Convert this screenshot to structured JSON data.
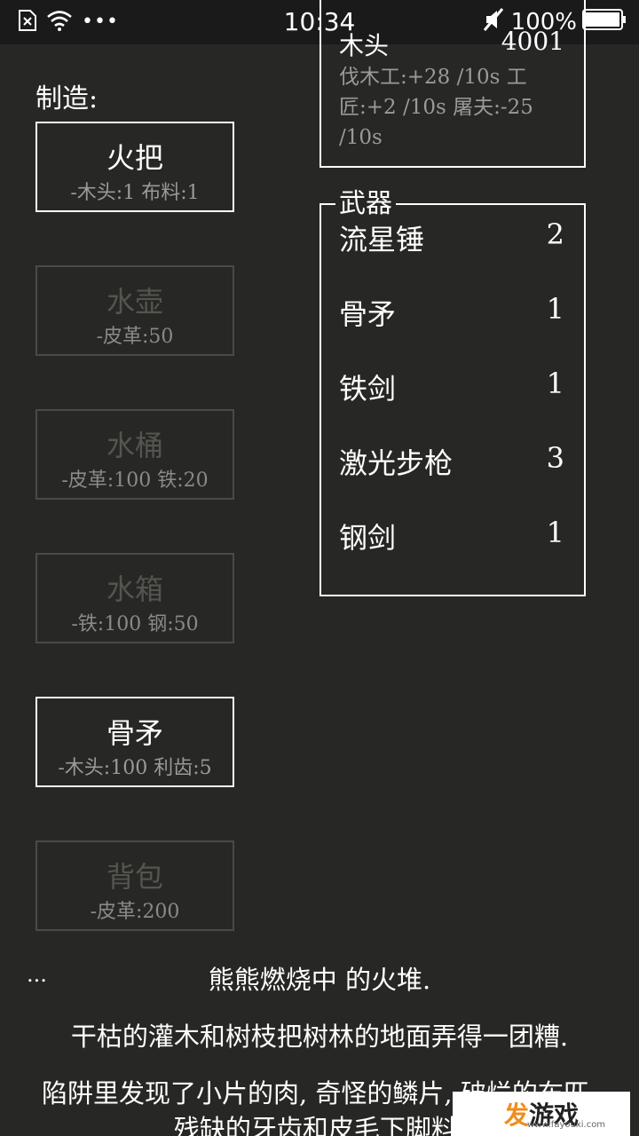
{
  "status_bar": {
    "time": "10:34",
    "battery": "100%",
    "icons": [
      "sim-card-icon",
      "wifi-icon",
      "more-dots-icon",
      "mute-icon",
      "battery-icon"
    ]
  },
  "build": {
    "label": "制造:",
    "items": [
      {
        "name": "火把",
        "cost": "-木头:1 布料:1",
        "enabled": true
      },
      {
        "name": "水壶",
        "cost": "-皮革:50",
        "enabled": false
      },
      {
        "name": "水桶",
        "cost": "-皮革:100 铁:20",
        "enabled": false
      },
      {
        "name": "水箱",
        "cost": "-铁:100 钢:50",
        "enabled": false
      },
      {
        "name": "骨矛",
        "cost": "-木头:100 利齿:5",
        "enabled": true
      },
      {
        "name": "背包",
        "cost": "-皮革:200",
        "enabled": false
      }
    ]
  },
  "stores": {
    "row_name": "木头",
    "row_value": "4001",
    "tooltip": "伐木工:+28 /10s 工匠:+2 /10s 屠夫:-25 /10s"
  },
  "weapons": {
    "title": "武器",
    "items": [
      {
        "name": "流星锤",
        "count": "2"
      },
      {
        "name": "骨矛",
        "count": "1"
      },
      {
        "name": "铁剑",
        "count": "1"
      },
      {
        "name": "激光步枪",
        "count": "3"
      },
      {
        "name": "钢剑",
        "count": "1"
      }
    ]
  },
  "notifications": {
    "ellipsis": "...",
    "messages": [
      "熊熊燃烧中 的火堆.",
      "干枯的灌木和树枝把树林的地面弄得一团糟.",
      "陷阱里发现了小片的肉, 奇怪的鳞片, 破烂的布匹, 残缺的牙齿和皮毛下脚料."
    ]
  },
  "watermark": {
    "logo_accent": "发",
    "logo_rest": "游戏",
    "url": "www.fayouxi.com"
  },
  "colors": {
    "background": "#272725",
    "text": "#ffffff",
    "muted": "#9a9a98",
    "disabled_border": "#4a4a48",
    "disabled_text": "#55554f",
    "watermark_orange": "#f08c1e"
  }
}
